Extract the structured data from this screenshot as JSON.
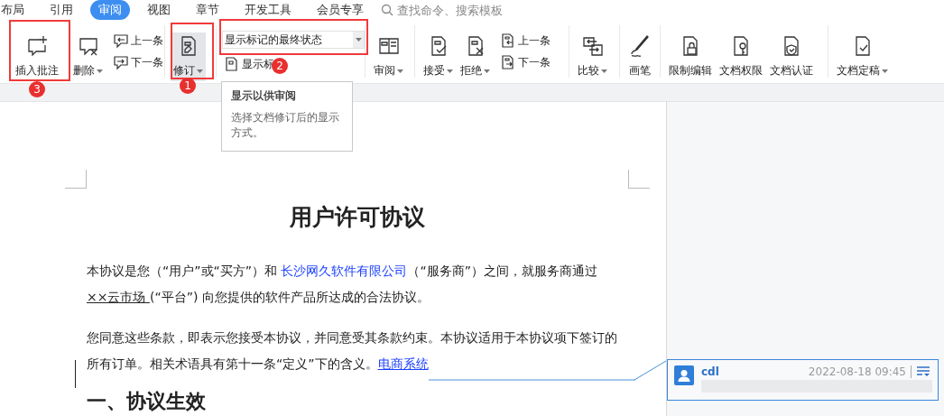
{
  "menu_tabs": [
    {
      "label": "布局",
      "selected": false
    },
    {
      "label": "引用",
      "selected": false
    },
    {
      "label": "审阅",
      "selected": true
    },
    {
      "label": "视图",
      "selected": false
    },
    {
      "label": "章节",
      "selected": false
    },
    {
      "label": "开发工具",
      "selected": false
    },
    {
      "label": "会员专享",
      "selected": false
    }
  ],
  "search": {
    "placeholder": "查找命令、搜索模板"
  },
  "ribbon_groups": [
    {
      "items": [
        {
          "kind": "large",
          "label": "插入批注",
          "dropdown": false,
          "on": false
        },
        {
          "kind": "large",
          "label": "删除",
          "dropdown": true,
          "on": false
        },
        {
          "kind": "stack",
          "entries": [
            "上一条",
            "下一条"
          ]
        }
      ]
    },
    {
      "items": [
        {
          "kind": "large",
          "label": "修订",
          "dropdown": true,
          "on": true
        }
      ]
    },
    {
      "items": [
        {
          "kind": "select",
          "value": "显示标记的最终状态",
          "below": "显示标"
        }
      ]
    },
    {
      "items": [
        {
          "kind": "large",
          "label": "审阅",
          "dropdown": true,
          "on": false
        }
      ]
    },
    {
      "items": [
        {
          "kind": "large",
          "label": "接受",
          "dropdown": true,
          "on": false
        },
        {
          "kind": "large",
          "label": "拒绝",
          "dropdown": true,
          "on": false
        },
        {
          "kind": "stack",
          "entries": [
            "上一条",
            "下一条"
          ]
        }
      ]
    },
    {
      "items": [
        {
          "kind": "large",
          "label": "比较",
          "dropdown": true,
          "on": false
        }
      ]
    },
    {
      "items": [
        {
          "kind": "large",
          "label": "画笔",
          "dropdown": false,
          "on": false
        }
      ]
    },
    {
      "items": [
        {
          "kind": "large",
          "label": "限制编辑",
          "dropdown": false,
          "on": false
        },
        {
          "kind": "large",
          "label": "文档权限",
          "dropdown": false,
          "on": false
        },
        {
          "kind": "large",
          "label": "文档认证",
          "dropdown": false,
          "on": false
        }
      ]
    },
    {
      "items": [
        {
          "kind": "large",
          "label": "文档定稿",
          "dropdown": true,
          "on": false
        }
      ]
    }
  ],
  "tooltip": {
    "title": "显示以供审阅",
    "text": "选择文档修订后的显示方式。"
  },
  "annotations": [
    {
      "number": "1"
    },
    {
      "number": "2"
    },
    {
      "number": "3"
    }
  ],
  "document": {
    "title": "用户许可协议",
    "paragraphs": [
      [
        {
          "kind": "plain",
          "text": "本协议是您（“用户”或“买方”）和 "
        },
        {
          "kind": "link",
          "text": "长沙网久软件有限公司"
        },
        {
          "kind": "plain",
          "text": "（“服务商”）之间，就服务商通过 "
        },
        {
          "kind": "underline",
          "text": "××云市场 "
        },
        {
          "kind": "plain",
          "text": "(“平台”) 向您提供的软件产品所达成的合法协议。"
        }
      ],
      [
        {
          "kind": "plain",
          "text": "您同意这些条款，即表示您接受本协议，并同意受其条款约束。本协议适用于本协议项下签订的所有订单。相关术语具有第十一条“定义”下的含义。"
        },
        {
          "kind": "link",
          "text": "电商系统"
        }
      ]
    ],
    "heading": "一、协议生效"
  },
  "comment": {
    "author": "cdl",
    "time": "2022-08-18 09:45"
  }
}
